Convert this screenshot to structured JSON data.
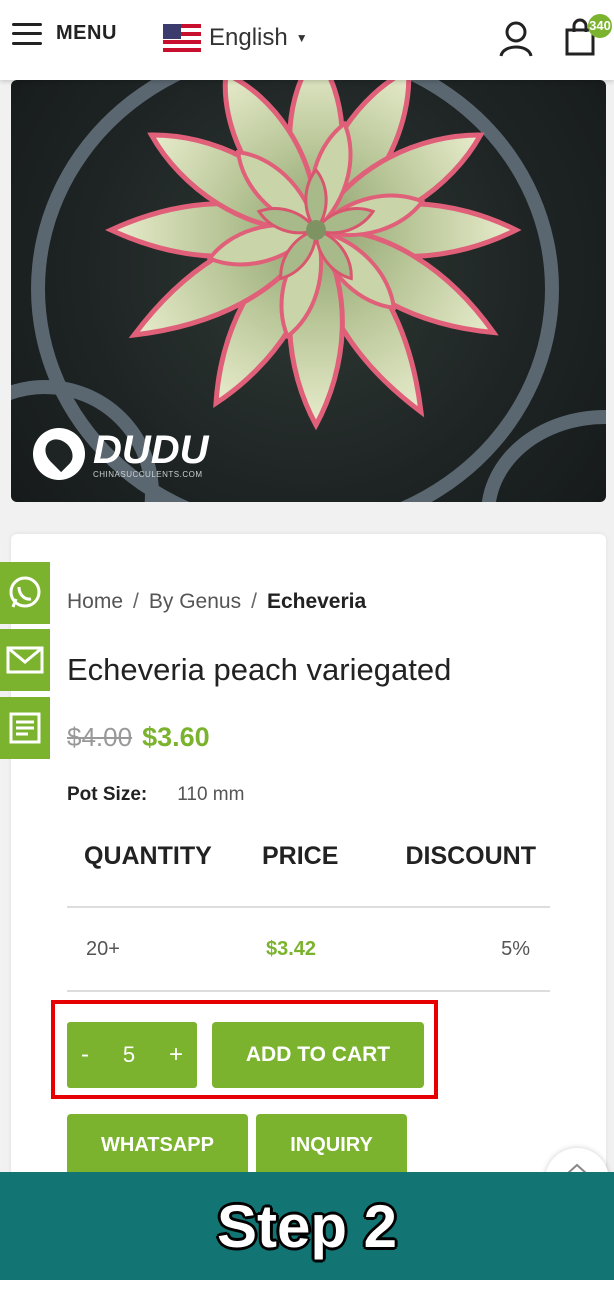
{
  "header": {
    "menu_label": "MENU",
    "language": "English",
    "cart_count": "340"
  },
  "hero": {
    "brand": "DUDU",
    "brand_sub": "CHINASUCCULENTS.COM"
  },
  "breadcrumb": {
    "home": "Home",
    "sep1": "/",
    "genus": "By Genus",
    "sep2": "/",
    "current": "Echeveria"
  },
  "product": {
    "title": "Echeveria peach variegated",
    "old_price": "$4.00",
    "price": "$3.60",
    "pot_label": "Pot Size:",
    "pot_value": "110 mm"
  },
  "discount_table": {
    "headers": [
      "QUANTITY",
      "PRICE",
      "DISCOUNT"
    ],
    "rows": [
      {
        "quantity": "20+",
        "price": "$3.42",
        "discount": "5%"
      }
    ]
  },
  "cart": {
    "minus": "-",
    "quantity": "5",
    "plus": "+",
    "add_label": "ADD TO CART"
  },
  "actions": {
    "whatsapp": "WHATSAPP",
    "inquiry": "INQUIRY"
  },
  "side_icons": [
    "whatsapp-icon",
    "email-icon",
    "form-icon"
  ],
  "banner": {
    "text": "Step 2"
  },
  "colors": {
    "accent": "#7bb32e",
    "banner": "#127473",
    "highlight": "#e60000"
  }
}
